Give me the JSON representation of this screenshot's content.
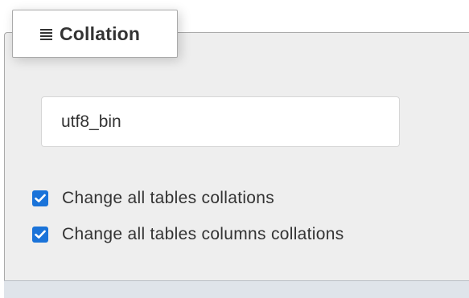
{
  "legend": {
    "title": "Collation",
    "icon": "list-lines-icon"
  },
  "collation_input": {
    "value": "utf8_bin"
  },
  "options": [
    {
      "label": "Change all tables collations",
      "checked": true
    },
    {
      "label": "Change all tables columns collations",
      "checked": true
    }
  ],
  "colors": {
    "checkbox": "#1a73d9",
    "panel_bg": "#eeeeee",
    "text": "#333333"
  }
}
